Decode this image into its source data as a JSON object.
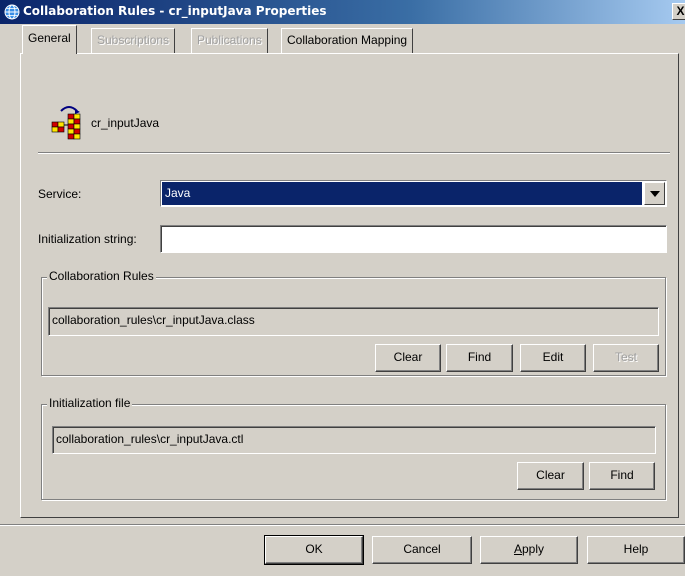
{
  "window": {
    "title": "Collaboration Rules - cr_inputJava Properties",
    "close_label": "X",
    "icon": "globe-icon"
  },
  "tabs": [
    {
      "label": "General",
      "state": "active"
    },
    {
      "label": "Subscriptions",
      "state": "disabled"
    },
    {
      "label": "Publications",
      "state": "disabled"
    },
    {
      "label": "Collaboration Mapping",
      "state": "enabled"
    }
  ],
  "header": {
    "name": "cr_inputJava",
    "icon": "collaboration-rules-icon"
  },
  "service": {
    "label": "Service:",
    "value": "Java"
  },
  "init_string": {
    "label": "Initialization string:",
    "value": ""
  },
  "collab_rules": {
    "title": "Collaboration Rules",
    "path": "collaboration_rules\\cr_inputJava.class",
    "clear": "Clear",
    "find": "Find",
    "edit": "Edit",
    "test": "Test"
  },
  "init_file": {
    "title": "Initialization file",
    "path": "collaboration_rules\\cr_inputJava.ctl",
    "clear": "Clear",
    "find": "Find"
  },
  "footer": {
    "ok": "OK",
    "cancel": "Cancel",
    "apply_mnemonic": "A",
    "apply_rest": "pply",
    "help": "Help"
  },
  "colors": {
    "face": "#d4d0c8",
    "title_start": "#0a246a",
    "title_end": "#a6caf0",
    "selection": "#0a246a"
  }
}
